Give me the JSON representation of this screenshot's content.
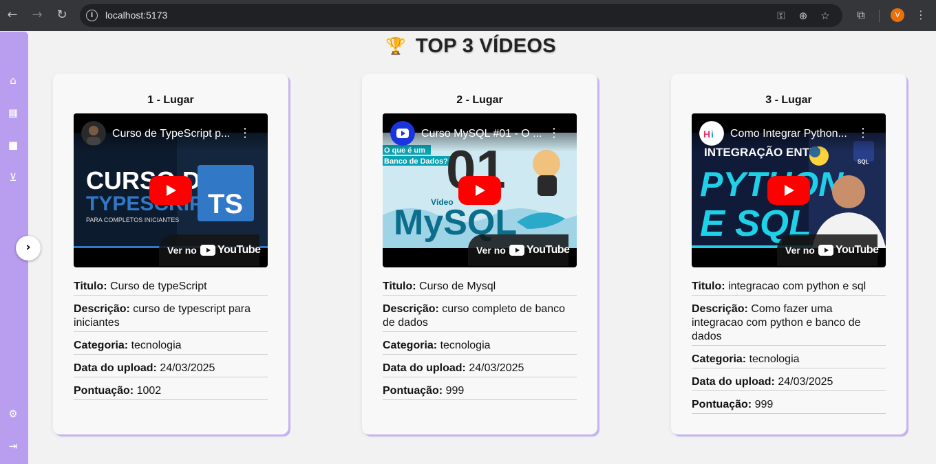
{
  "browser": {
    "url": "localhost:5173",
    "profile_initial": "V",
    "icons": {
      "back": "arrow-left-icon",
      "forward": "arrow-right-icon",
      "reload": "reload-icon",
      "info": "info-icon",
      "password": "key-icon",
      "zoom": "zoom-icon",
      "bookmark": "star-icon",
      "extensions": "puzzle-icon",
      "menu": "three-dots-icon"
    }
  },
  "sidebar": {
    "items": [
      {
        "name": "home-icon",
        "glyph": "⌂"
      },
      {
        "name": "film-icon",
        "glyph": "▦"
      },
      {
        "name": "video-camera-icon",
        "glyph": "■"
      },
      {
        "name": "upload-icon",
        "glyph": "⊻"
      }
    ],
    "bottom": [
      {
        "name": "gear-icon",
        "glyph": "⚙"
      },
      {
        "name": "logout-icon",
        "glyph": "⇥"
      }
    ],
    "expand_glyph": "›"
  },
  "page": {
    "title": "TOP 3 VÍDEOS",
    "trophy": "🏆"
  },
  "labels": {
    "titulo": "Titulo:",
    "descricao": "Descrição:",
    "categoria": "Categoria:",
    "data": "Data do upload:",
    "pontuacao": "Pontuação:",
    "watch_on": "Ver no",
    "youtube": "YouTube"
  },
  "videos": [
    {
      "place": "1 - Lugar",
      "embed_title": "Curso de TypeScript p...",
      "titulo": "Curso de typeScript",
      "descricao": "curso de typescript para iniciantes",
      "categoria": "tecnologia",
      "data": "24/03/2025",
      "pontuacao": "1002",
      "thumb_text_1": "CURSO DE",
      "thumb_text_2": "TYPESCRIPT",
      "thumb_text_3": "PARA COMPLETOS INICIANTES",
      "thumb_badge": "TS"
    },
    {
      "place": "2 - Lugar",
      "embed_title": "Curso MySQL #01 - O ...",
      "titulo": "Curso de Mysql",
      "descricao": "curso completo de banco de dados",
      "categoria": "tecnologia",
      "data": "24/03/2025",
      "pontuacao": "999",
      "thumb_text_1": "O que é um",
      "thumb_text_2": "Banco de Dados?",
      "thumb_text_3": "MySQL",
      "thumb_badge": "01",
      "thumb_text_4": "Vídeo"
    },
    {
      "place": "3 - Lugar",
      "embed_title": "Como Integrar Python...",
      "titulo": "integracao com python e sql",
      "descricao": "Como fazer uma integracao com python e banco de dados",
      "categoria": "tecnologia",
      "data": "24/03/2025",
      "pontuacao": "999",
      "thumb_text_1": "INTEGRAÇÃO ENTRE",
      "thumb_text_2": "PYTHON",
      "thumb_text_3": "E SQL",
      "thumb_badge": "SQL"
    }
  ],
  "colors": {
    "sidebar": "#b99ef0",
    "youtube_red": "#ff0000",
    "card_shadow": "#c5b3f2"
  }
}
